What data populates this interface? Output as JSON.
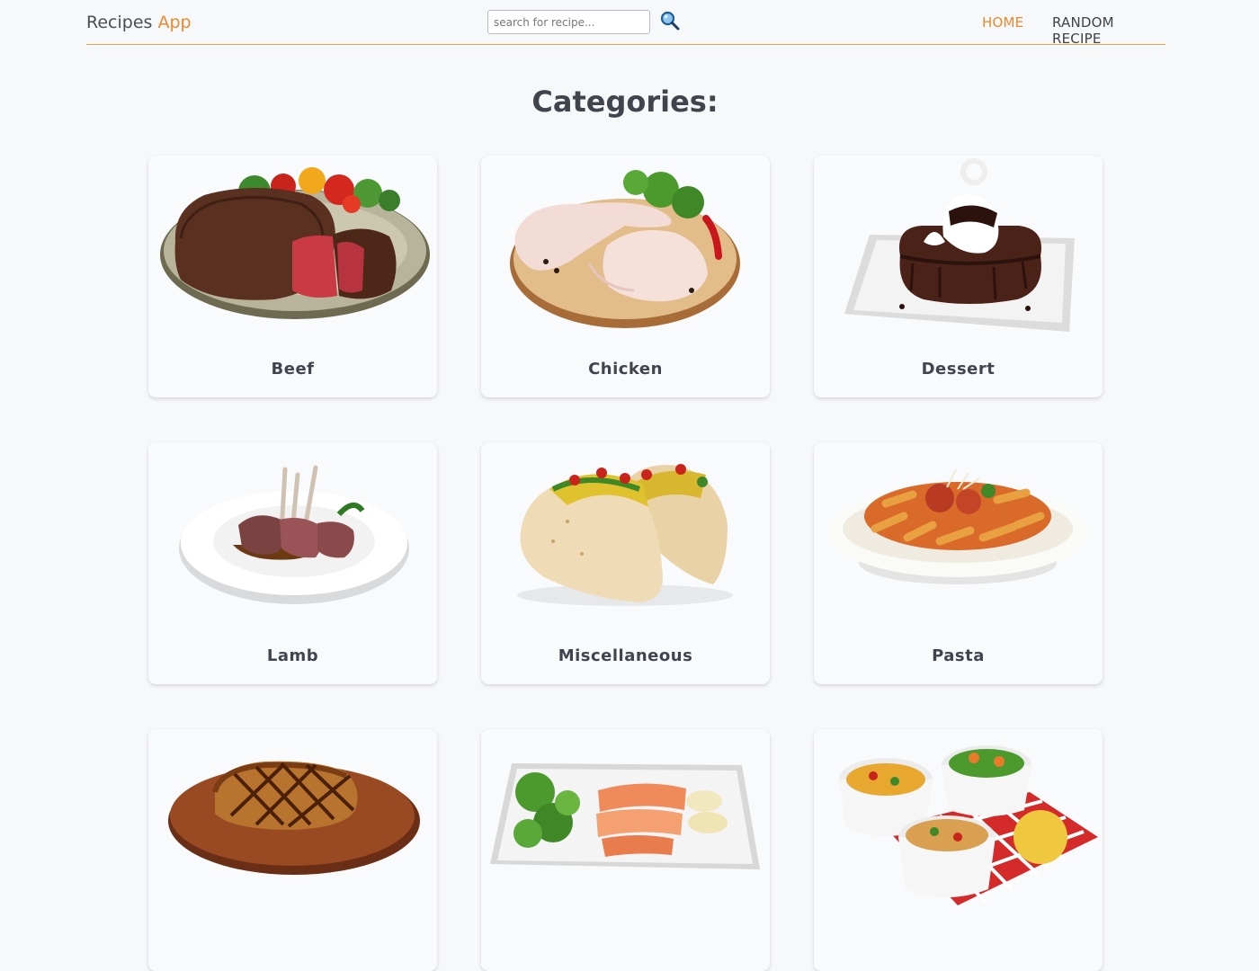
{
  "app": {
    "title_main": "Recipes",
    "title_accent": "App"
  },
  "search": {
    "placeholder": "search for recipe..."
  },
  "nav": {
    "home": "HOME",
    "random": "RANDOM RECIPE"
  },
  "colors": {
    "accent": "#e8892c",
    "background": "#f7f8fa",
    "text": "#40454d"
  },
  "page": {
    "heading": "Categories:"
  },
  "categories": [
    {
      "label": "Beef",
      "icon": "beef-steak-image"
    },
    {
      "label": "Chicken",
      "icon": "raw-chicken-image"
    },
    {
      "label": "Dessert",
      "icon": "chocolate-dessert-image"
    },
    {
      "label": "Lamb",
      "icon": "lamb-rack-image"
    },
    {
      "label": "Miscellaneous",
      "icon": "tacos-image"
    },
    {
      "label": "Pasta",
      "icon": "penne-pasta-image"
    },
    {
      "label": "",
      "icon": "pork-chop-image"
    },
    {
      "label": "",
      "icon": "salmon-plate-image"
    },
    {
      "label": "",
      "icon": "side-dishes-image"
    }
  ]
}
